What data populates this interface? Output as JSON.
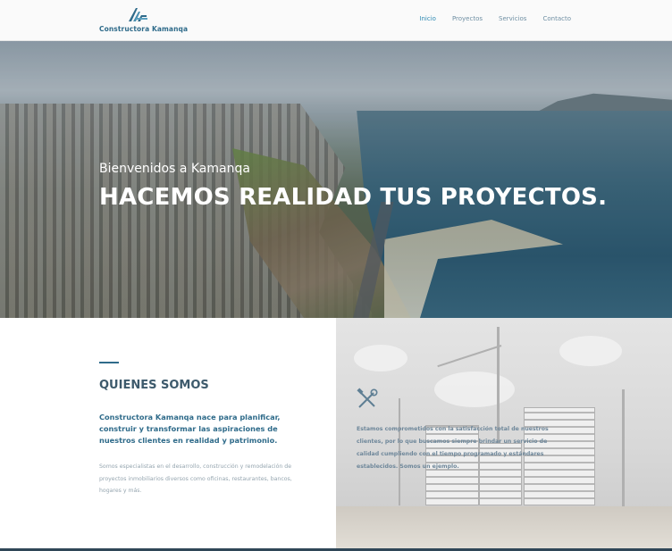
{
  "header": {
    "logo_text": "Constructora Kamanqa",
    "logo_icon": "building-triangle-logo",
    "nav": [
      {
        "label": "Inicio",
        "active": true
      },
      {
        "label": "Proyectos",
        "active": false
      },
      {
        "label": "Servicios",
        "active": false
      },
      {
        "label": "Contacto",
        "active": false
      }
    ]
  },
  "hero": {
    "subtitle": "Bienvenidos a Kamanqa",
    "title": "HACEMOS REALIDAD TUS PROYECTOS."
  },
  "about": {
    "heading": "QUIENES SOMOS",
    "lead": "Constructora Kamanqa nace para planificar, construir y transformar las aspiraciones de nuestros clientes en realidad y patrimonio.",
    "body": "Somos especialistas en el desarrollo, construcción y remodelación de proyectos inmobiliarios diversos como oficinas, restaurantes, bancos, hogares y más."
  },
  "feature": {
    "icon": "tools-icon",
    "text": "Estamos comprometidos con la satisfacción total de nuestros clientes, por lo que buscamos siempre brindar un servicio de calidad cumpliendo con el tiempo programado y estándares establecidos. Somos un ejemplo."
  },
  "colors": {
    "brand": "#2f6b8a",
    "nav_active": "#2f8ab3",
    "heading": "#3d5a6c"
  }
}
